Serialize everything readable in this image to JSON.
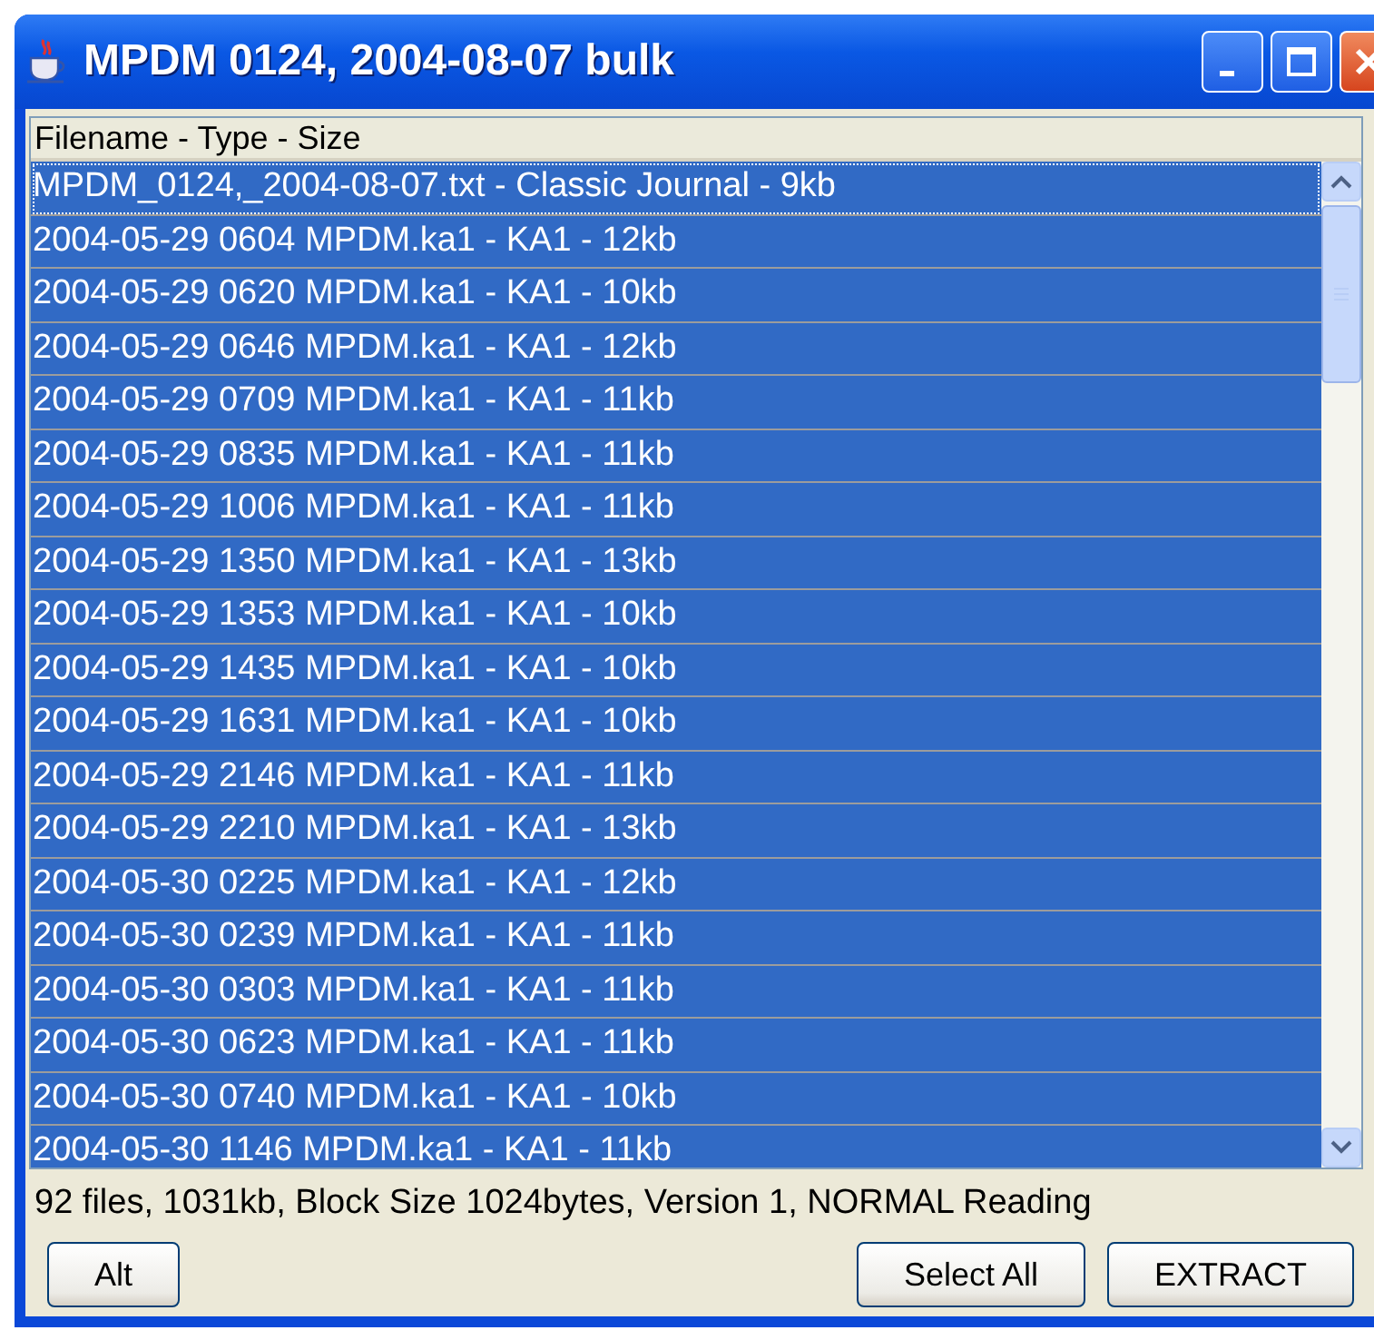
{
  "window": {
    "title": "MPDM 0124, 2004-08-07 bulk"
  },
  "table": {
    "columns": [
      "Filename - Type - Size"
    ],
    "rows": [
      {
        "text": "MPDM_0124,_2004-08-07.txt - Classic Journal - 9kb",
        "selected": true,
        "focused": true
      },
      {
        "text": "2004-05-29 0604 MPDM.ka1 - KA1 - 12kb",
        "selected": true,
        "focused": false
      },
      {
        "text": "2004-05-29 0620 MPDM.ka1 - KA1 - 10kb",
        "selected": true,
        "focused": false
      },
      {
        "text": "2004-05-29 0646 MPDM.ka1 - KA1 - 12kb",
        "selected": true,
        "focused": false
      },
      {
        "text": "2004-05-29 0709 MPDM.ka1 - KA1 - 11kb",
        "selected": true,
        "focused": false
      },
      {
        "text": "2004-05-29 0835 MPDM.ka1 - KA1 - 11kb",
        "selected": true,
        "focused": false
      },
      {
        "text": "2004-05-29 1006 MPDM.ka1 - KA1 - 11kb",
        "selected": true,
        "focused": false
      },
      {
        "text": "2004-05-29 1350 MPDM.ka1 - KA1 - 13kb",
        "selected": true,
        "focused": false
      },
      {
        "text": "2004-05-29 1353 MPDM.ka1 - KA1 - 10kb",
        "selected": true,
        "focused": false
      },
      {
        "text": "2004-05-29 1435 MPDM.ka1 - KA1 - 10kb",
        "selected": true,
        "focused": false
      },
      {
        "text": "2004-05-29 1631 MPDM.ka1 - KA1 - 10kb",
        "selected": true,
        "focused": false
      },
      {
        "text": "2004-05-29 2146 MPDM.ka1 - KA1 - 11kb",
        "selected": true,
        "focused": false
      },
      {
        "text": "2004-05-29 2210 MPDM.ka1 - KA1 - 13kb",
        "selected": true,
        "focused": false
      },
      {
        "text": "2004-05-30 0225 MPDM.ka1 - KA1 - 12kb",
        "selected": true,
        "focused": false
      },
      {
        "text": "2004-05-30 0239 MPDM.ka1 - KA1 - 11kb",
        "selected": true,
        "focused": false
      },
      {
        "text": "2004-05-30 0303 MPDM.ka1 - KA1 - 11kb",
        "selected": true,
        "focused": false
      },
      {
        "text": "2004-05-30 0623 MPDM.ka1 - KA1 - 11kb",
        "selected": true,
        "focused": false
      },
      {
        "text": "2004-05-30 0740 MPDM.ka1 - KA1 - 10kb",
        "selected": true,
        "focused": false
      },
      {
        "text": "2004-05-30 1146 MPDM.ka1 - KA1 - 11kb",
        "selected": true,
        "focused": false
      }
    ]
  },
  "status_bar": "92 files, 1031kb, Block Size 1024bytes, Version 1, NORMAL Reading",
  "buttons_left": [
    "Alt"
  ],
  "buttons_right": [
    "Select All",
    "EXTRACT"
  ]
}
